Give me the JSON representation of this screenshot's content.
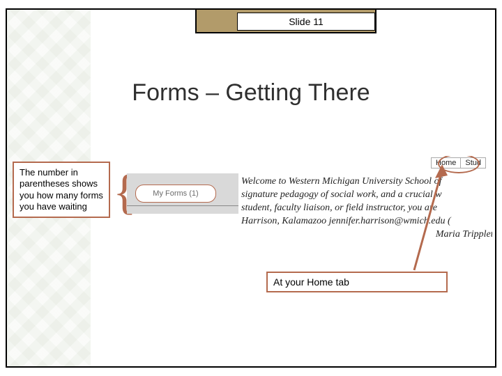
{
  "slide_label": "Slide 11",
  "heading": "Forms – Getting There",
  "left_callout": "The number in parentheses shows you how many forms you have waiting",
  "my_forms_label": "My Forms (1)",
  "tabs": {
    "home": "Home",
    "next": "Stud"
  },
  "welcome_line1": "Welcome to Western Michigan University School of",
  "welcome_line2": "signature pedagogy of social work, and a crucial w",
  "welcome_line3": "student, faculty liaison, or field instructor, you are",
  "welcome_line4": "Harrison, Kalamazoo jennifer.harrison@wmich.edu (",
  "welcome_line5": "Maria Tripplett, Southwe",
  "bottom_callout": "At your Home tab"
}
